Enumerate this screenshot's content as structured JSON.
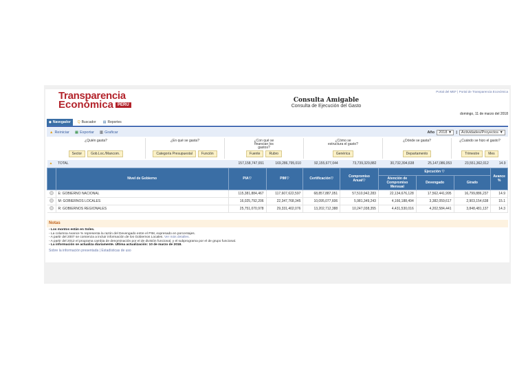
{
  "header": {
    "logo_line1": "Transparencia",
    "logo_line2": "Económica",
    "logo_badge": "PERÚ",
    "title": "Consulta Amigable",
    "subtitle": "Consulta de Ejecución del Gasto",
    "portal_links": [
      "Portal del MEF",
      "Portal de Transparencia Económica"
    ],
    "date": "domingo, 11 de marzo del 2018"
  },
  "tabs": [
    {
      "label": "Navegador",
      "active": true
    },
    {
      "label": "Buscador"
    },
    {
      "label": "Reportes"
    }
  ],
  "toolbar": {
    "reset": "Reiniciar",
    "export": "Exportar",
    "chart": "Graficar",
    "year_label": "Año",
    "year": "2018 ▼",
    "type": "Actividades/Proyectos ▼"
  },
  "questions": [
    {
      "label": "¿Quién gasta?",
      "buttons": [
        "Sector",
        "Gob.Loc./Mancom."
      ]
    },
    {
      "label": "¿En qué se gasta?",
      "buttons": [
        "Categoría Presupuestal",
        "Función"
      ]
    },
    {
      "label": "¿Con qué se financian los gastos?",
      "buttons": [
        "Fuente",
        "Rubro"
      ]
    },
    {
      "label": "¿Cómo se estructura el gasto?",
      "buttons": [
        "Genérica"
      ]
    },
    {
      "label": "¿Dónde se gasta?",
      "buttons": [
        "Departamento"
      ]
    },
    {
      "label": "¿Cuándo se hizo el gasto?",
      "buttons": [
        "Trimestre",
        "Mes"
      ]
    }
  ],
  "table": {
    "total": {
      "label": "TOTAL",
      "values": [
        "157,158,747,651",
        "169,286,795,010",
        "92,155,677,044",
        "73,739,329,882",
        "30,732,394,638",
        "25,147,086,053",
        "23,551,362,012",
        "14.9"
      ]
    },
    "headers": {
      "nivel": "Nivel de Gobierno",
      "pia": "PIA",
      "pim": "PIM",
      "cert": "Certificación",
      "comp": "Compromiso Anual",
      "ejec": "Ejecución",
      "aten": "Atención de Compromiso Mensual",
      "dev": "Devengado",
      "gir": "Girado",
      "avance": "Avance %"
    },
    "rows": [
      {
        "name": "E: GOBIERNO NACIONAL",
        "values": [
          "115,381,884,467",
          "117,607,622,597",
          "68,857,887,051",
          "57,510,942,283",
          "22,134,676,128",
          "17,562,441,995",
          "16,799,886,237",
          "14.9"
        ]
      },
      {
        "name": "M: GOBIERNOS LOCALES",
        "values": [
          "16,025,792,206",
          "22,347,768,345",
          "10,095,077,606",
          "5,981,349,243",
          "4,166,188,494",
          "3,382,059,617",
          "2,903,154,638",
          "15.1"
        ]
      },
      {
        "name": "R: GOBIERNOS REGIONALES",
        "values": [
          "25,751,070,978",
          "29,331,402,076",
          "13,202,712,388",
          "10,247,038,355",
          "4,431,530,016",
          "4,202,584,441",
          "3,848,481,137",
          "14.3"
        ]
      }
    ]
  },
  "notes": {
    "title": "Notas",
    "lines": [
      "- Los montos están en Soles.",
      "- La columna Avance % representa la razón del Devengado entre el PIM, expresado en porcentajes.",
      "- A partir del 2007 se comienza a incluir información de los Gobiernos Locales.",
      "- A partir del 2012 el programa cambia de denominación por el de división funcional, y el subprograma por el de grupo funcional.",
      "- La información se actualiza diariamente. Última actualización: 10 de marzo de 2018."
    ],
    "more_link": "Ver más detalles.",
    "footer_links": [
      "Sobre la información presentada",
      "Estadísticas de uso"
    ]
  }
}
